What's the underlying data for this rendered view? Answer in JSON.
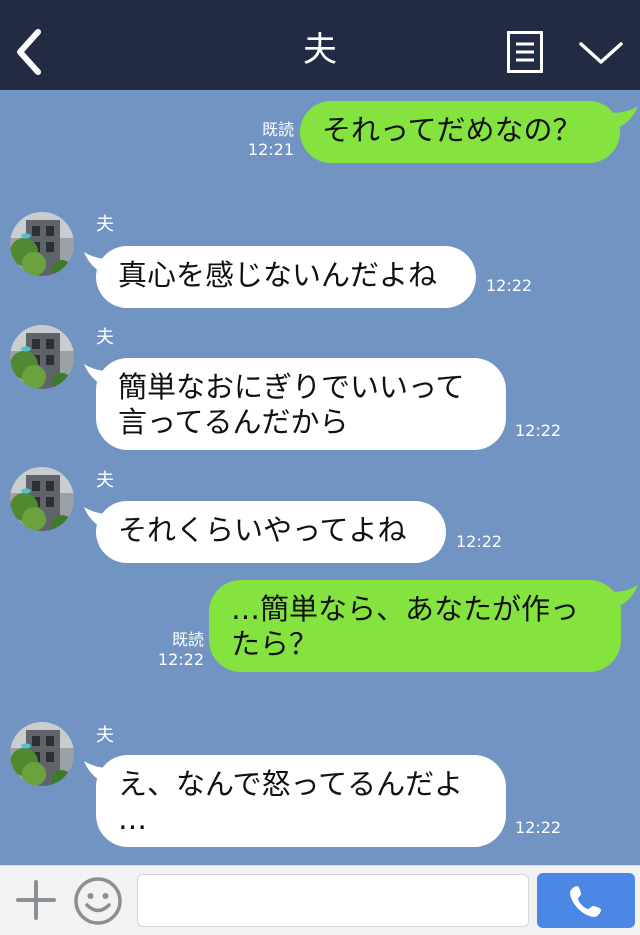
{
  "header": {
    "title": "夫"
  },
  "messages": [
    {
      "from": "me",
      "text": "それってだめなの？",
      "read": "既読",
      "time": "12:21"
    },
    {
      "from": "them",
      "sender": "夫",
      "text": "真心を感じないんだよね",
      "time": "12:22"
    },
    {
      "from": "them",
      "sender": "夫",
      "text": "簡単なおにぎりでいいって\n言ってるんだから",
      "time": "12:22"
    },
    {
      "from": "them",
      "sender": "夫",
      "text": "それくらいやってよね",
      "time": "12:22"
    },
    {
      "from": "me",
      "text": "…簡単なら、あなたが作っ\nたら？",
      "read": "既読",
      "time": "12:22"
    },
    {
      "from": "them",
      "sender": "夫",
      "text": "え、なんで怒ってるんだよ\n…",
      "time": "12:22"
    }
  ],
  "footer": {
    "input_value": ""
  },
  "colors": {
    "header_bg": "#222b43",
    "chat_bg": "#7294c2",
    "my_bubble": "#84e33e",
    "their_bubble": "#ffffff",
    "call_button": "#4c87e6"
  },
  "icons": [
    "back-chevron-icon",
    "menu-list-icon",
    "chevron-down-icon",
    "plus-icon",
    "smiley-icon",
    "phone-icon"
  ]
}
